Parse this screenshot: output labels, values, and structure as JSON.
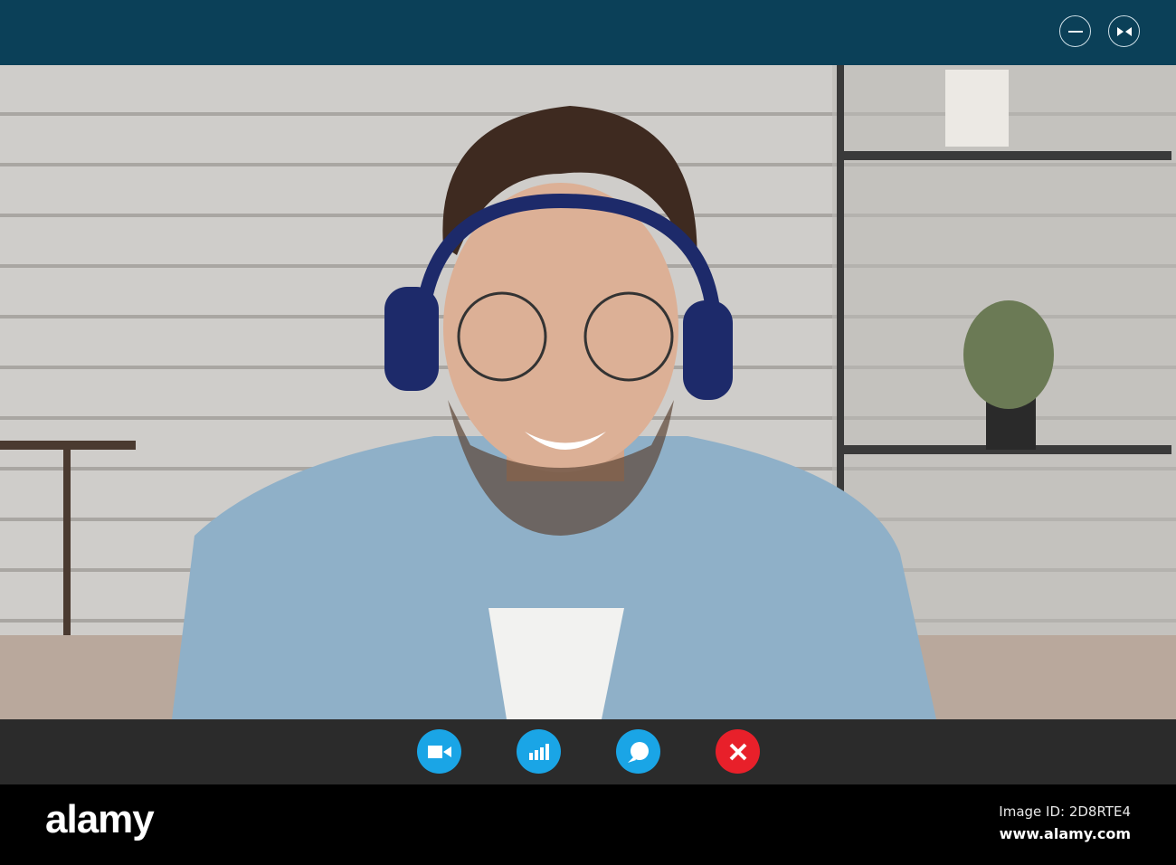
{
  "window": {
    "minimize_icon": "minimize-icon",
    "collapse_icon": "collapse-arrows-icon"
  },
  "controls": [
    {
      "name": "video-camera-button",
      "icon": "video-camera-icon",
      "color": "#1aa5e6"
    },
    {
      "name": "signal-button",
      "icon": "signal-bars-icon",
      "color": "#1aa5e6"
    },
    {
      "name": "chat-button",
      "icon": "chat-bubble-icon",
      "color": "#1aa5e6"
    },
    {
      "name": "end-call-button",
      "icon": "close-icon",
      "color": "#e8202a"
    }
  ],
  "footer": {
    "logo": "alamy",
    "image_id": "Image ID: 2D8RTE4",
    "site": "www.alamy.com"
  }
}
